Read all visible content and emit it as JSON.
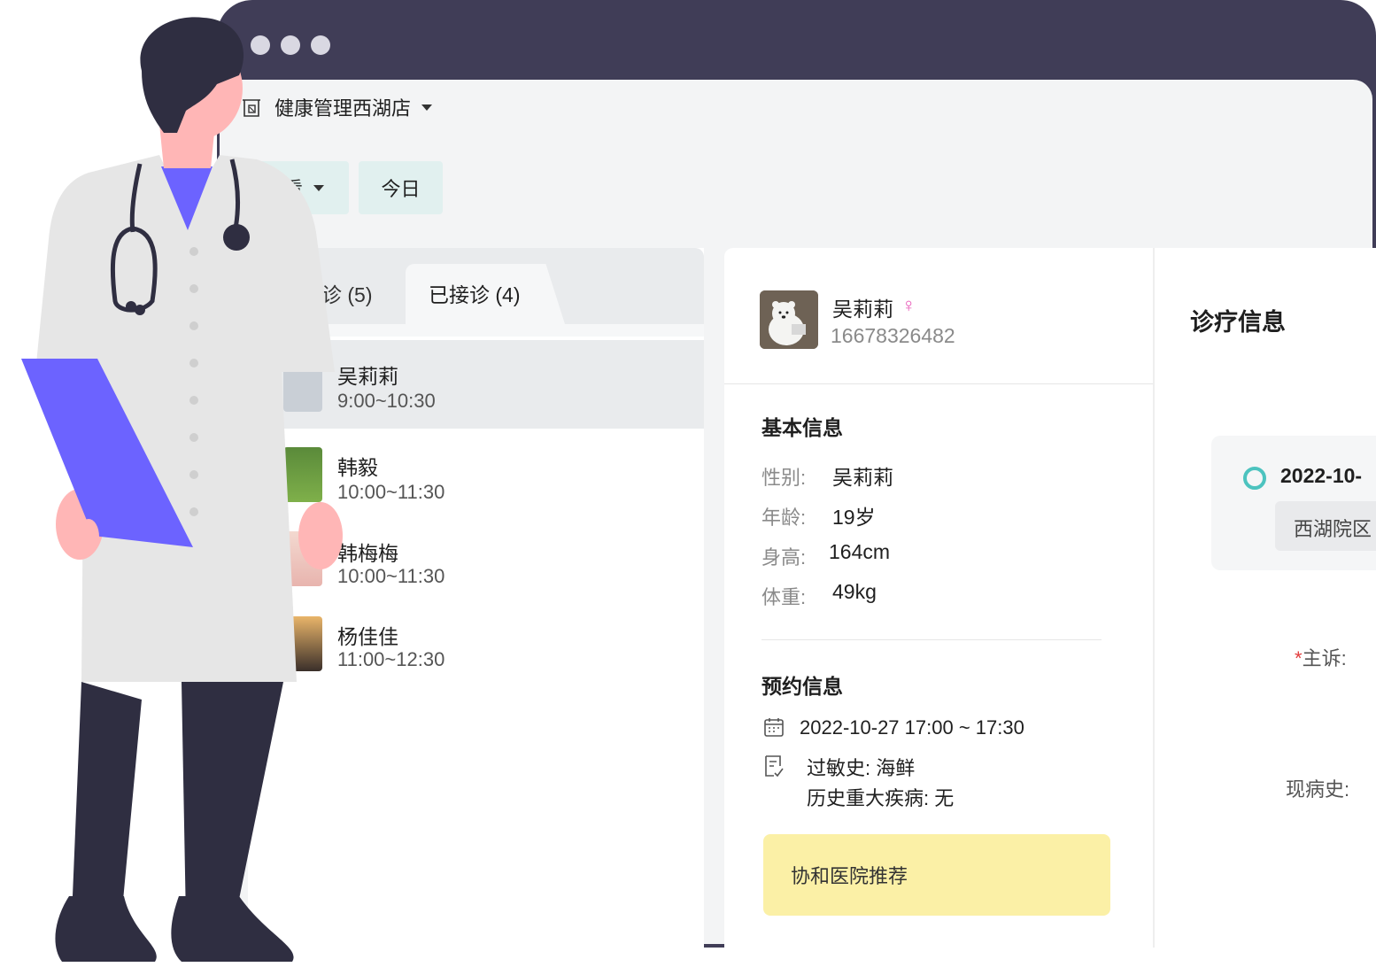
{
  "store": {
    "name": "健康管理西湖店"
  },
  "toolbar": {
    "view_label": "查看",
    "today_label": "今日"
  },
  "tabs": {
    "waiting": "待诊 (5)",
    "done": "已接诊 (4)"
  },
  "patients": [
    {
      "name": "吴莉莉",
      "time": "9:00~10:30"
    },
    {
      "name": "韩毅",
      "time": "10:00~11:30"
    },
    {
      "name": "韩梅梅",
      "time": "10:00~11:30"
    },
    {
      "name": "杨佳佳",
      "time": "11:00~12:30"
    }
  ],
  "detail": {
    "name": "吴莉莉",
    "gender_icon": "female-icon",
    "gender_symbol": "♀",
    "phone": "16678326482",
    "basic": {
      "title": "基本信息",
      "rows": [
        {
          "label": "性别:",
          "value": "吴莉莉"
        },
        {
          "label": "年龄:",
          "value": "19岁"
        },
        {
          "label": "身高:",
          "value": "164cm"
        },
        {
          "label": "体重:",
          "value": "49kg"
        }
      ]
    },
    "appointment": {
      "title": "预约信息",
      "time": "2022-10-27 17:00 ~ 17:30",
      "allergy": "过敏史:  海鲜",
      "major_illness": "历史重大疾病:  无"
    },
    "note": "协和医院推荐"
  },
  "treatment": {
    "title": "诊疗信息",
    "record_date": "2022-10-",
    "record_branch": "西湖院区",
    "chief_complaint_required": "*",
    "chief_complaint_label": "主诉:",
    "present_illness_label": "现病史:"
  },
  "colors": {
    "frame": "#403d57",
    "accent_teal": "#4cc3bf",
    "note_yellow": "#fbf0a6",
    "coat_purple": "#6c63ff",
    "female_pink": "#e85bb8"
  }
}
